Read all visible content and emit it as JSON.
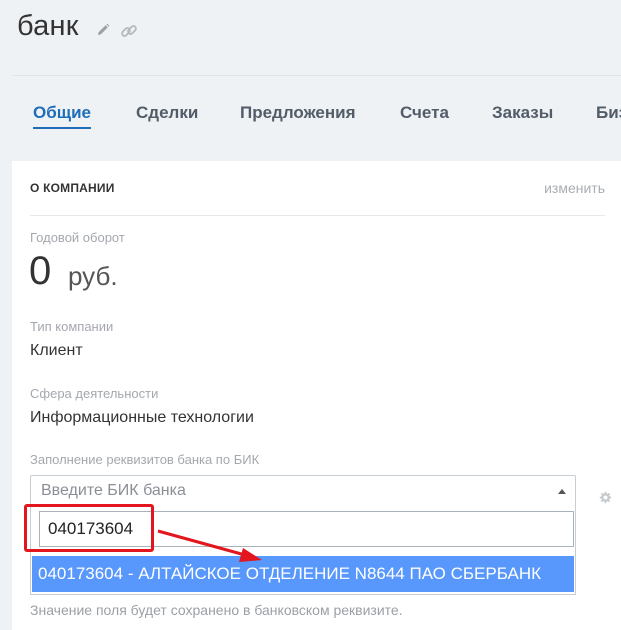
{
  "page": {
    "title": "банк"
  },
  "icons": {
    "edit": "pencil-icon",
    "link": "chain-link-icon",
    "settings": "gear-icon",
    "dropdown": "caret-up-icon"
  },
  "tabs": [
    {
      "label": "Общие",
      "active": true
    },
    {
      "label": "Сделки",
      "active": false
    },
    {
      "label": "Предложения",
      "active": false
    },
    {
      "label": "Счета",
      "active": false
    },
    {
      "label": "Заказы",
      "active": false
    },
    {
      "label": "Биз",
      "active": false
    }
  ],
  "about": {
    "title": "О КОМПАНИИ",
    "edit_label": "изменить",
    "revenue_label": "Годовой оборот",
    "revenue_value": "0",
    "revenue_currency": "руб.",
    "type_label": "Тип компании",
    "type_value": "Клиент",
    "industry_label": "Сфера деятельности",
    "industry_value": "Информационные технологии"
  },
  "bik": {
    "label": "Заполнение реквизитов банка по БИК",
    "placeholder": "Введите БИК банка",
    "search_value": "040173604",
    "option": "040173604 - АЛТАЙСКОЕ ОТДЕЛЕНИЕ N8644 ПАО СБЕРБАНК",
    "hint": "Значение поля будет сохранено в банковском реквизите."
  },
  "colors": {
    "accent": "#1f6cb8",
    "highlight": "#5897fb",
    "annotation": "#e3161f"
  }
}
